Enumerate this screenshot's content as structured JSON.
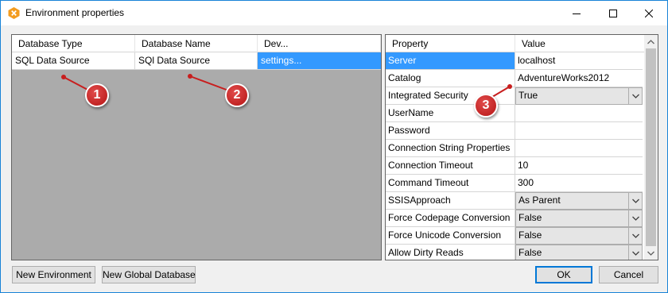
{
  "window": {
    "title": "Environment properties",
    "app_icon": "x-app-icon"
  },
  "title_controls": {
    "minimize": "minimize-icon",
    "maximize": "maximize-icon",
    "close": "close-icon"
  },
  "database_grid": {
    "columns": [
      "Database Type",
      "Database Name",
      "Dev..."
    ],
    "rows": [
      {
        "type": "SQL Data Source",
        "name": "SQl Data Source",
        "dev": "settings..."
      }
    ]
  },
  "property_grid": {
    "columns": [
      "Property",
      "Value"
    ],
    "rows": [
      {
        "property": "Server",
        "value": "localhost",
        "selected": true,
        "combo": false
      },
      {
        "property": "Catalog",
        "value": "AdventureWorks2012",
        "combo": false
      },
      {
        "property": "Integrated Security",
        "value": "True",
        "combo": true
      },
      {
        "property": "UserName",
        "value": "",
        "combo": false
      },
      {
        "property": "Password",
        "value": "",
        "combo": false
      },
      {
        "property": "Connection String Properties",
        "value": "",
        "combo": false
      },
      {
        "property": "Connection Timeout",
        "value": "10",
        "combo": false
      },
      {
        "property": "Command Timeout",
        "value": "300",
        "combo": false
      },
      {
        "property": "SSISApproach",
        "value": "As Parent",
        "combo": true
      },
      {
        "property": "Force Codepage Conversion",
        "value": "False",
        "combo": true
      },
      {
        "property": "Force Unicode Conversion",
        "value": "False",
        "combo": true
      },
      {
        "property": "Allow Dirty Reads",
        "value": "False",
        "combo": true
      }
    ]
  },
  "buttons": {
    "new_environment": "New Environment",
    "new_global_database": "New Global Database",
    "ok": "OK",
    "cancel": "Cancel"
  },
  "callouts": [
    "1",
    "2",
    "3"
  ],
  "colors": {
    "selection": "#3399ff",
    "accent": "#0078d7",
    "callout": "#c81e1e"
  }
}
